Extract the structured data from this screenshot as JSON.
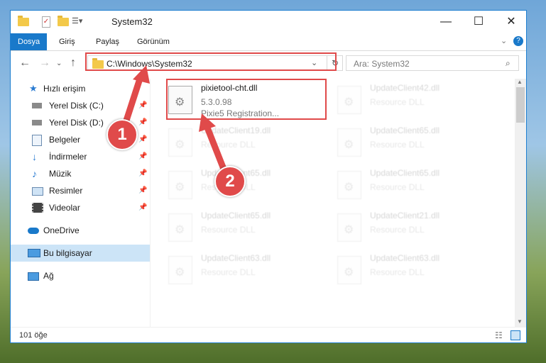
{
  "window": {
    "title": "System32",
    "accent": "#1979ca"
  },
  "ribbon": {
    "tabs": [
      "Dosya",
      "Giriş",
      "Paylaş",
      "Görünüm"
    ]
  },
  "address": {
    "path": "C:\\Windows\\System32",
    "search_placeholder": "Ara: System32"
  },
  "sidebar": {
    "items": [
      {
        "label": "Hızlı erişim",
        "icon": "star-icon"
      },
      {
        "label": "Yerel Disk (C:)",
        "icon": "drive-icon",
        "pinned": true
      },
      {
        "label": "Yerel Disk (D:)",
        "icon": "drive-icon",
        "pinned": true
      },
      {
        "label": "Belgeler",
        "icon": "documents-icon",
        "pinned": true
      },
      {
        "label": "İndirmeler",
        "icon": "download-icon",
        "pinned": true
      },
      {
        "label": "Müzik",
        "icon": "music-icon",
        "pinned": true
      },
      {
        "label": "Resimler",
        "icon": "pictures-icon",
        "pinned": true
      },
      {
        "label": "Videolar",
        "icon": "videos-icon",
        "pinned": true
      },
      {
        "label": "OneDrive",
        "icon": "cloud-icon"
      },
      {
        "label": "Bu bilgisayar",
        "icon": "computer-icon",
        "selected": true
      },
      {
        "label": "Ağ",
        "icon": "network-icon"
      }
    ]
  },
  "files": {
    "highlighted": {
      "name": "pixietool-cht.dll",
      "version": "5.3.0.98",
      "description": "Pixie5 Registration..."
    },
    "left_column": [
      {
        "name": "UpdateClient19.dll",
        "description": "Resource DLL"
      },
      {
        "name": "UpdateClient65.dll",
        "description": "Resource DLL"
      },
      {
        "name": "UpdateClient65.dll",
        "description": "Resource DLL"
      },
      {
        "name": "UpdateClient63.dll",
        "description": "Resource DLL"
      }
    ],
    "right_column": [
      {
        "name": "UpdateClient42.dll",
        "description": "Resource DLL"
      },
      {
        "name": "UpdateClient65.dll",
        "description": "Resource DLL"
      },
      {
        "name": "UpdateClient65.dll",
        "description": "Resource DLL"
      },
      {
        "name": "UpdateClient21.dll",
        "description": "Resource DLL"
      },
      {
        "name": "UpdateClient63.dll",
        "description": "Resource DLL"
      }
    ]
  },
  "status": {
    "count": "101 öğe"
  },
  "annotations": {
    "step1": "1",
    "step2": "2",
    "color": "#e04a4a"
  }
}
